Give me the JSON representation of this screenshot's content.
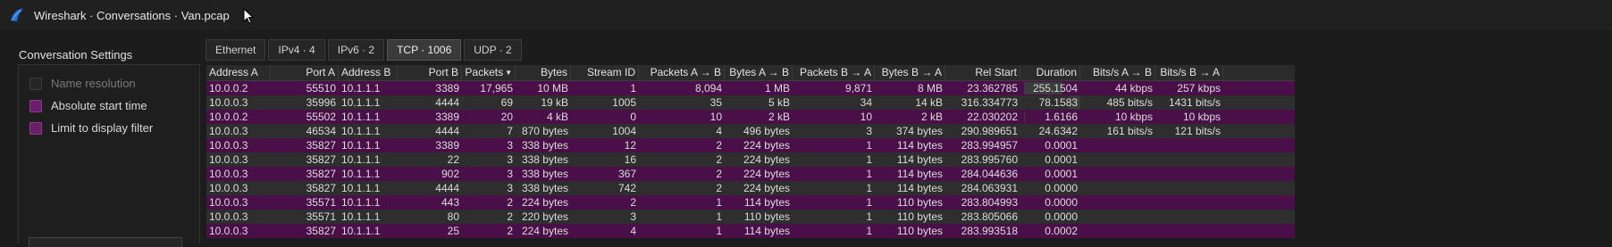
{
  "window": {
    "title": "Wireshark · Conversations · Van.pcap"
  },
  "settings": {
    "heading": "Conversation Settings",
    "options": [
      {
        "label": "Name resolution",
        "checked": false,
        "disabled": true
      },
      {
        "label": "Absolute start time",
        "checked": true,
        "disabled": false
      },
      {
        "label": "Limit to display filter",
        "checked": true,
        "disabled": false
      }
    ]
  },
  "tabs": [
    {
      "label": "Ethernet",
      "active": false
    },
    {
      "label": "IPv4 · 4",
      "active": false
    },
    {
      "label": "IPv6 · 2",
      "active": false
    },
    {
      "label": "TCP · 1006",
      "active": true
    },
    {
      "label": "UDP · 2",
      "active": false
    }
  ],
  "table": {
    "columns": [
      "Address A",
      "Port A",
      "Address B",
      "Port B",
      "Packets",
      "Bytes",
      "Stream ID",
      "Packets A → B",
      "Bytes A → B",
      "Packets B → A",
      "Bytes B → A",
      "Rel Start",
      "Duration",
      "Bits/s A → B",
      "Bits/s B → A"
    ],
    "sort_indicator": "▼",
    "rows": [
      [
        "10.0.0.2",
        "55510",
        "10.1.1.1",
        "3389",
        "17,965",
        "10 MB",
        "1",
        "8,094",
        "1 MB",
        "9,871",
        "8 MB",
        "23.362785",
        "255.1504",
        "44 kbps",
        "257 kbps"
      ],
      [
        "10.0.0.3",
        "35996",
        "10.1.1.1",
        "4444",
        "69",
        "19 kB",
        "1005",
        "35",
        "5 kB",
        "34",
        "14 kB",
        "316.334773",
        "78.1583",
        "485 bits/s",
        "1431 bits/s"
      ],
      [
        "10.0.0.2",
        "55502",
        "10.1.1.1",
        "3389",
        "20",
        "4 kB",
        "0",
        "10",
        "2 kB",
        "10",
        "2 kB",
        "22.030202",
        "1.6166",
        "10 kbps",
        "10 kbps"
      ],
      [
        "10.0.0.3",
        "46534",
        "10.1.1.1",
        "4444",
        "7",
        "870 bytes",
        "1004",
        "4",
        "496 bytes",
        "3",
        "374 bytes",
        "290.989651",
        "24.6342",
        "161 bits/s",
        "121 bits/s"
      ],
      [
        "10.0.0.3",
        "35827",
        "10.1.1.1",
        "3389",
        "3",
        "338 bytes",
        "12",
        "2",
        "224 bytes",
        "1",
        "114 bytes",
        "283.994957",
        "0.0001",
        "",
        ""
      ],
      [
        "10.0.0.3",
        "35827",
        "10.1.1.1",
        "22",
        "3",
        "338 bytes",
        "16",
        "2",
        "224 bytes",
        "1",
        "114 bytes",
        "283.995760",
        "0.0001",
        "",
        ""
      ],
      [
        "10.0.0.3",
        "35827",
        "10.1.1.1",
        "902",
        "3",
        "338 bytes",
        "367",
        "2",
        "224 bytes",
        "1",
        "114 bytes",
        "284.044636",
        "0.0001",
        "",
        ""
      ],
      [
        "10.0.0.3",
        "35827",
        "10.1.1.1",
        "4444",
        "3",
        "338 bytes",
        "742",
        "2",
        "224 bytes",
        "1",
        "114 bytes",
        "284.063931",
        "0.0000",
        "",
        ""
      ],
      [
        "10.0.0.3",
        "35571",
        "10.1.1.1",
        "443",
        "2",
        "224 bytes",
        "2",
        "1",
        "114 bytes",
        "1",
        "110 bytes",
        "283.804993",
        "0.0000",
        "",
        ""
      ],
      [
        "10.0.0.3",
        "35571",
        "10.1.1.1",
        "80",
        "2",
        "220 bytes",
        "3",
        "1",
        "110 bytes",
        "1",
        "110 bytes",
        "283.805066",
        "0.0000",
        "",
        ""
      ],
      [
        "10.0.0.3",
        "35827",
        "10.1.1.1",
        "25",
        "2",
        "224 bytes",
        "4",
        "1",
        "114 bytes",
        "1",
        "110 bytes",
        "283.993518",
        "0.0002",
        "",
        ""
      ]
    ]
  },
  "colors": {
    "row_even": "#2e2e2e",
    "row_odd": "#4a0f48",
    "checkbox_on": "#6b1d6b",
    "accent": "#1e6fd9"
  }
}
